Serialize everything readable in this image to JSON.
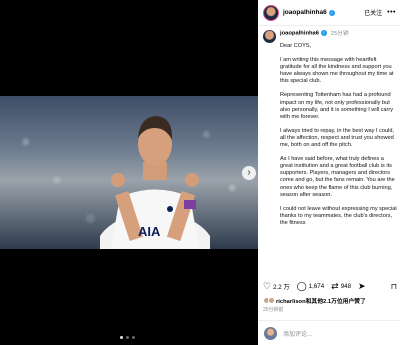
{
  "header": {
    "username": "joaopalhinha6",
    "follow_label": "已关注",
    "more": "•••"
  },
  "caption": {
    "username": "joaopalhinha6",
    "time": "25分钟",
    "paragraphs": [
      "Dear COYS,",
      "I am writing this message with heartfelt gratitude for all the kindness and support you have always shown me throughout my time at this special club.",
      "Representing Tottenham has had a profound impact on my life, not only professionally but also personally, and it is something I will carry with me forever.",
      "I always tried to repay, in the best way I could, all the affection, respect and trust you showed me, both on and off the pitch.",
      "As I have said before, what truly defines a great institution and a great football club is its supporters. Players, managers and directors come and go, but the fans remain. You are the ones who keep the flame of this club burning, season after season.",
      "I could not leave without expressing my special thanks to my teammates, the club's directors, the fitness"
    ]
  },
  "actions": {
    "likes_count": "2.2 万",
    "comments_count": "1,674",
    "shares_count": "948"
  },
  "likes": {
    "text": "richarlison和其他2.1万位用户赞了"
  },
  "posted_time": "25分钟前",
  "comment": {
    "placeholder": "添加评论..."
  },
  "icons": {
    "heart": "heart-icon",
    "comment": "comment-icon",
    "repost": "repost-icon",
    "share": "share-icon",
    "bookmark": "bookmark-icon",
    "next": "chevron-right-icon"
  },
  "colors": {
    "verified": "#1d9bf0",
    "jersey_logo": "#0a1e5a"
  }
}
